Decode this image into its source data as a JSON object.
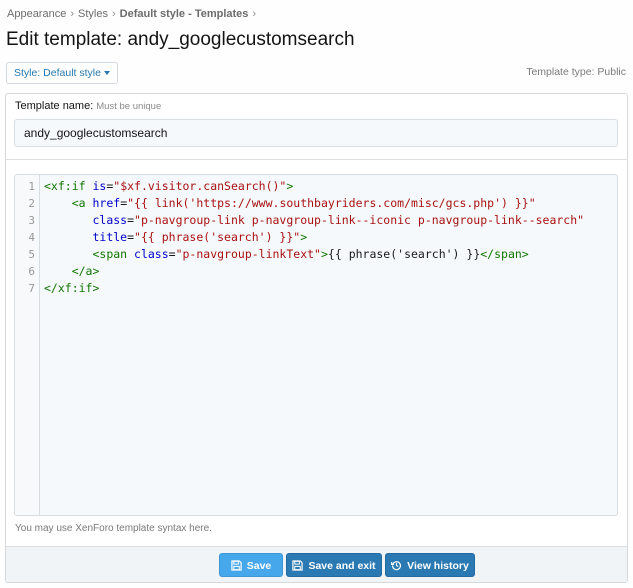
{
  "breadcrumb": {
    "items": [
      "Appearance",
      "Styles",
      "Default style - Templates"
    ],
    "separator": "›"
  },
  "page": {
    "title": "Edit template: andy_googlecustomsearch"
  },
  "style_selector": {
    "label": "Style: Default style"
  },
  "template_type": "Template type: Public",
  "template_name": {
    "label": "Template name:",
    "hint": "Must be unique",
    "value": "andy_googlecustomsearch"
  },
  "editor": {
    "line_numbers": [
      "1",
      "2",
      "3",
      "4",
      "5",
      "6",
      "7"
    ],
    "hint": "You may use XenForo template syntax here."
  },
  "actions": {
    "save": "Save",
    "save_exit": "Save and exit",
    "view_history": "View history"
  },
  "colors": {
    "link": "#2577b1",
    "primary_button": "#2a79b3",
    "save_button": "#47a7eb",
    "code_tag": "#117700",
    "code_attr": "#0000cc",
    "code_string": "#aa1111"
  },
  "icons": {
    "save": "floppy-disk-icon",
    "history": "history-icon",
    "dropdown": "caret-down-icon"
  }
}
